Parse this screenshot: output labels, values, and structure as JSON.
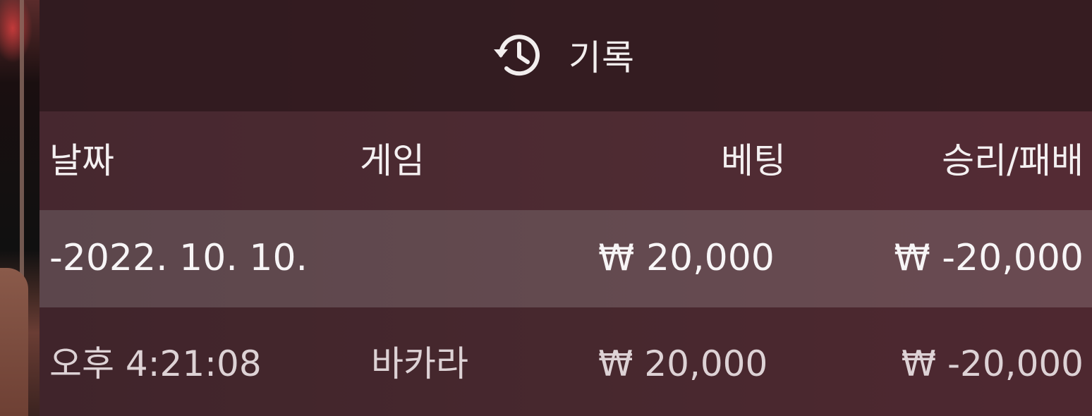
{
  "panel": {
    "title": "기록",
    "title_icon": "history-icon"
  },
  "columns": {
    "date": "날짜",
    "game": "게임",
    "bet": "베팅",
    "win_loss": "승리/패배"
  },
  "rows": [
    {
      "date": "-2022. 10. 10.",
      "game": "",
      "bet": "₩ 20,000",
      "win_loss": "₩ -20,000"
    },
    {
      "date": "오후 4:21:08",
      "game": "바카라",
      "bet": "₩ 20,000",
      "win_loss": "₩ -20,000"
    }
  ],
  "colors": {
    "panel_header_bg": "#301a1f",
    "highlight_row_bg": "#78646a",
    "text": "#f4f0f1"
  }
}
